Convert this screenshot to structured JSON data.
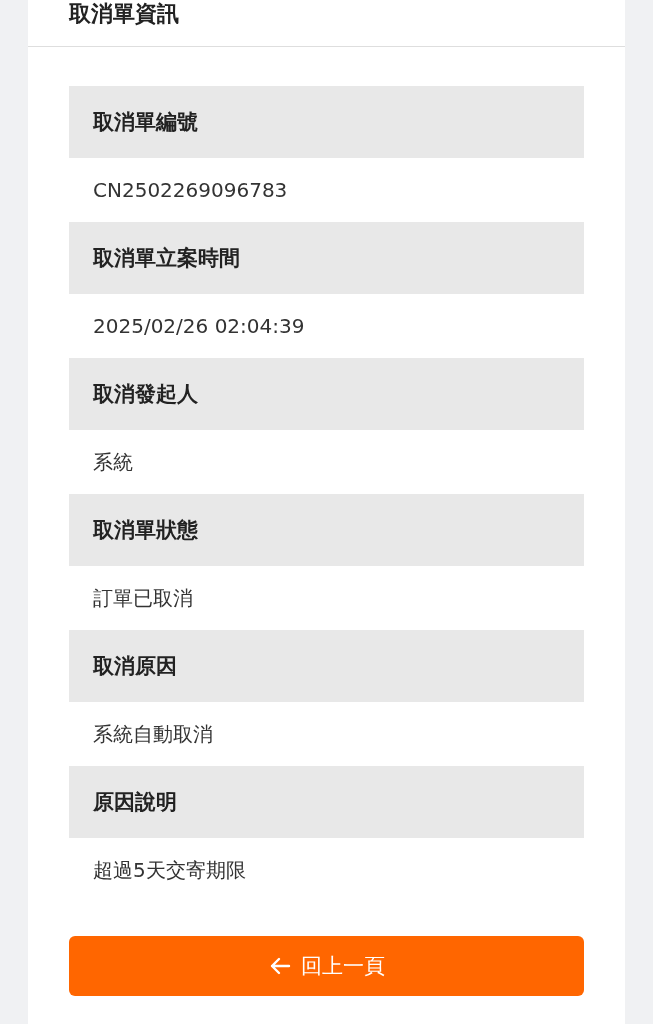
{
  "header": {
    "title": "取消單資訊"
  },
  "fields": [
    {
      "label": "取消單編號",
      "value": "CN2502269096783"
    },
    {
      "label": "取消單立案時間",
      "value": "2025/02/26 02:04:39"
    },
    {
      "label": "取消發起人",
      "value": "系統"
    },
    {
      "label": "取消單狀態",
      "value": "訂單已取消"
    },
    {
      "label": "取消原因",
      "value": "系統自動取消"
    },
    {
      "label": "原因說明",
      "value": "超過5天交寄期限"
    }
  ],
  "back_button": {
    "label": "回上一頁"
  }
}
